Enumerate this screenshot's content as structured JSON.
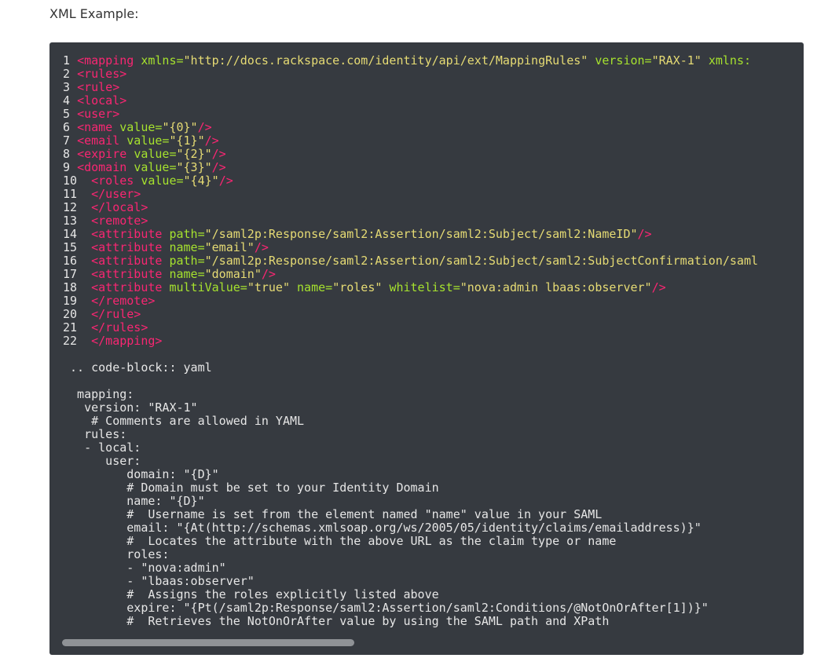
{
  "heading": "XML Example:",
  "xml_lines": [
    {
      "n": "1",
      "indent": "",
      "segs": [
        [
          "tag",
          "<mapping"
        ],
        [
          "txt",
          " "
        ],
        [
          "attr",
          "xmlns="
        ],
        [
          "str",
          "\"http://docs.rackspace.com/identity/api/ext/MappingRules\""
        ],
        [
          "txt",
          " "
        ],
        [
          "attr",
          "version="
        ],
        [
          "str",
          "\"RAX-1\""
        ],
        [
          "txt",
          " "
        ],
        [
          "attr",
          "xmlns:"
        ]
      ]
    },
    {
      "n": "2",
      "indent": "",
      "segs": [
        [
          "tag",
          "<rules>"
        ]
      ]
    },
    {
      "n": "3",
      "indent": "",
      "segs": [
        [
          "tag",
          "<rule>"
        ]
      ]
    },
    {
      "n": "4",
      "indent": "",
      "segs": [
        [
          "tag",
          "<local>"
        ]
      ]
    },
    {
      "n": "5",
      "indent": "",
      "segs": [
        [
          "tag",
          "<user>"
        ]
      ]
    },
    {
      "n": "6",
      "indent": "",
      "segs": [
        [
          "tag",
          "<name"
        ],
        [
          "txt",
          " "
        ],
        [
          "attr",
          "value="
        ],
        [
          "str",
          "\"{0}\""
        ],
        [
          "tag",
          "/>"
        ]
      ]
    },
    {
      "n": "7",
      "indent": "",
      "segs": [
        [
          "tag",
          "<email"
        ],
        [
          "txt",
          " "
        ],
        [
          "attr",
          "value="
        ],
        [
          "str",
          "\"{1}\""
        ],
        [
          "tag",
          "/>"
        ]
      ]
    },
    {
      "n": "8",
      "indent": "",
      "segs": [
        [
          "tag",
          "<expire"
        ],
        [
          "txt",
          " "
        ],
        [
          "attr",
          "value="
        ],
        [
          "str",
          "\"{2}\""
        ],
        [
          "tag",
          "/>"
        ]
      ]
    },
    {
      "n": "9",
      "indent": "",
      "segs": [
        [
          "tag",
          "<domain"
        ],
        [
          "txt",
          " "
        ],
        [
          "attr",
          "value="
        ],
        [
          "str",
          "\"{3}\""
        ],
        [
          "tag",
          "/>"
        ]
      ]
    },
    {
      "n": "10",
      "indent": " ",
      "segs": [
        [
          "tag",
          "<roles"
        ],
        [
          "txt",
          " "
        ],
        [
          "attr",
          "value="
        ],
        [
          "str",
          "\"{4}\""
        ],
        [
          "tag",
          "/>"
        ]
      ]
    },
    {
      "n": "11",
      "indent": " ",
      "segs": [
        [
          "tag",
          "</user>"
        ]
      ]
    },
    {
      "n": "12",
      "indent": " ",
      "segs": [
        [
          "tag",
          "</local>"
        ]
      ]
    },
    {
      "n": "13",
      "indent": " ",
      "segs": [
        [
          "tag",
          "<remote>"
        ]
      ]
    },
    {
      "n": "14",
      "indent": " ",
      "segs": [
        [
          "tag",
          "<attribute"
        ],
        [
          "txt",
          " "
        ],
        [
          "attr",
          "path="
        ],
        [
          "str",
          "\"/saml2p:Response/saml2:Assertion/saml2:Subject/saml2:NameID\""
        ],
        [
          "tag",
          "/>"
        ]
      ]
    },
    {
      "n": "15",
      "indent": " ",
      "segs": [
        [
          "tag",
          "<attribute"
        ],
        [
          "txt",
          " "
        ],
        [
          "attr",
          "name="
        ],
        [
          "str",
          "\"email\""
        ],
        [
          "tag",
          "/>"
        ]
      ]
    },
    {
      "n": "16",
      "indent": " ",
      "segs": [
        [
          "tag",
          "<attribute"
        ],
        [
          "txt",
          " "
        ],
        [
          "attr",
          "path="
        ],
        [
          "str",
          "\"/saml2p:Response/saml2:Assertion/saml2:Subject/saml2:SubjectConfirmation/saml"
        ]
      ]
    },
    {
      "n": "17",
      "indent": " ",
      "segs": [
        [
          "tag",
          "<attribute"
        ],
        [
          "txt",
          " "
        ],
        [
          "attr",
          "name="
        ],
        [
          "str",
          "\"domain\""
        ],
        [
          "tag",
          "/>"
        ]
      ]
    },
    {
      "n": "18",
      "indent": " ",
      "segs": [
        [
          "tag",
          "<attribute"
        ],
        [
          "txt",
          " "
        ],
        [
          "attr",
          "multiValue="
        ],
        [
          "str",
          "\"true\""
        ],
        [
          "txt",
          " "
        ],
        [
          "attr",
          "name="
        ],
        [
          "str",
          "\"roles\""
        ],
        [
          "txt",
          " "
        ],
        [
          "attr",
          "whitelist="
        ],
        [
          "str",
          "\"nova:admin lbaas:observer\""
        ],
        [
          "tag",
          "/>"
        ]
      ]
    },
    {
      "n": "19",
      "indent": " ",
      "segs": [
        [
          "tag",
          "</remote>"
        ]
      ]
    },
    {
      "n": "20",
      "indent": " ",
      "segs": [
        [
          "tag",
          "</rule>"
        ]
      ]
    },
    {
      "n": "21",
      "indent": " ",
      "segs": [
        [
          "tag",
          "</rules>"
        ]
      ]
    },
    {
      "n": "22",
      "indent": " ",
      "segs": [
        [
          "tag",
          "</mapping>"
        ]
      ]
    }
  ],
  "yaml_lines": [
    "",
    " .. code-block:: yaml",
    "",
    "  mapping:",
    "   version: \"RAX-1\"",
    "    # Comments are allowed in YAML",
    "   rules:",
    "   - local:",
    "      user:",
    "         domain: \"{D}\"",
    "         # Domain must be set to your Identity Domain",
    "         name: \"{D}\"",
    "         #  Username is set from the element named \"name\" value in your SAML",
    "         email: \"{At(http://schemas.xmlsoap.org/ws/2005/05/identity/claims/emailaddress)}\"",
    "         #  Locates the attribute with the above URL as the claim type or name",
    "         roles:",
    "         - \"nova:admin\"",
    "         - \"lbaas:observer\"",
    "         #  Assigns the roles explicitly listed above",
    "         expire: \"{Pt(/saml2p:Response/saml2:Assertion/saml2:Conditions/@NotOnOrAfter[1])}\"",
    "         #  Retrieves the NotOnOrAfter value by using the SAML path and XPath"
  ],
  "colors": {
    "background": "#363a40",
    "tag": "#f92672",
    "attr": "#a6e22e",
    "string": "#e6db74",
    "text": "#e6e6e6"
  }
}
